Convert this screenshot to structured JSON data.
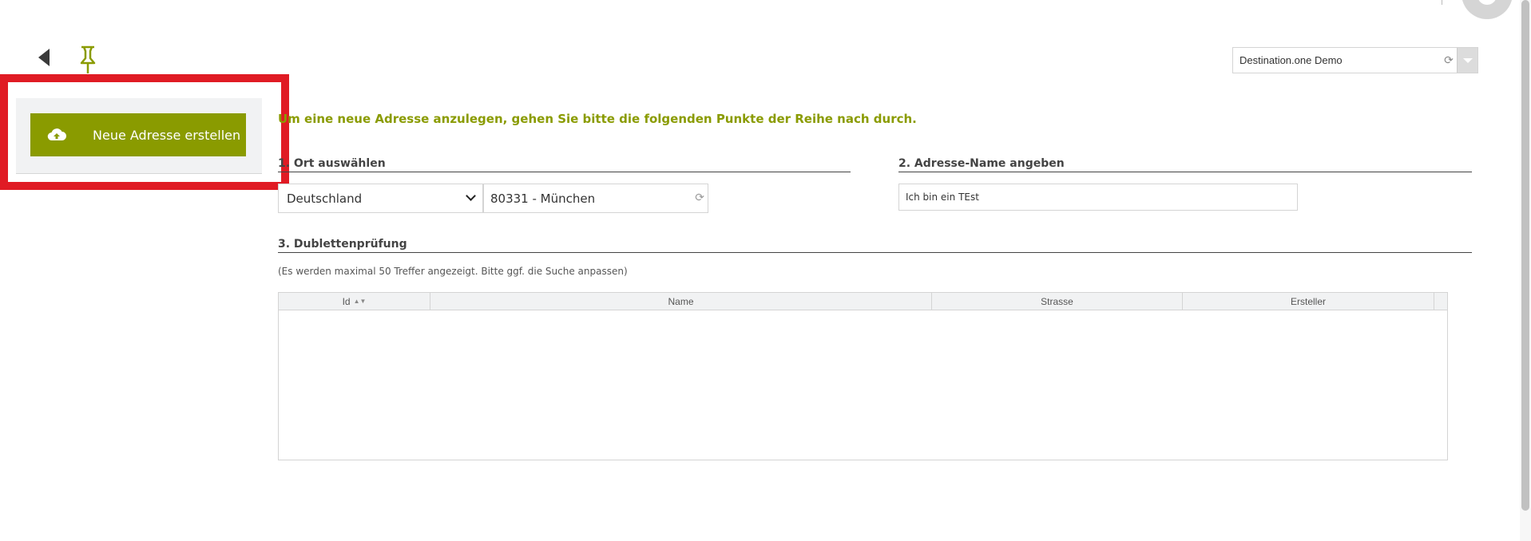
{
  "header": {
    "client_select": {
      "value": "Destination.one Demo"
    }
  },
  "sidebar": {
    "new_address_button": "Neue Adresse erstellen"
  },
  "main": {
    "intro": "Um eine neue Adresse anzulegen, gehen Sie bitte die folgenden Punkte der Reihe nach durch.",
    "step1_title": "1. Ort auswählen",
    "country_value": "Deutschland",
    "city_value": "80331 - München",
    "step2_title": "2. Adresse-Name angeben",
    "address_name_value": "Ich bin ein TEst",
    "step3_title": "3. Dublettenprüfung",
    "hint": "(Es werden maximal 50 Treffer angezeigt. Bitte ggf. die Suche anpassen)",
    "table": {
      "columns": [
        "Id",
        "Name",
        "Strasse",
        "Ersteller"
      ],
      "rows": []
    }
  },
  "colors": {
    "accent": "#8a9b00",
    "highlight_frame": "#e01b24"
  },
  "icons": [
    "back-arrow-icon",
    "pin-icon",
    "refresh-icon",
    "cloud-upload-icon",
    "chevron-down-icon",
    "sort-icon"
  ]
}
